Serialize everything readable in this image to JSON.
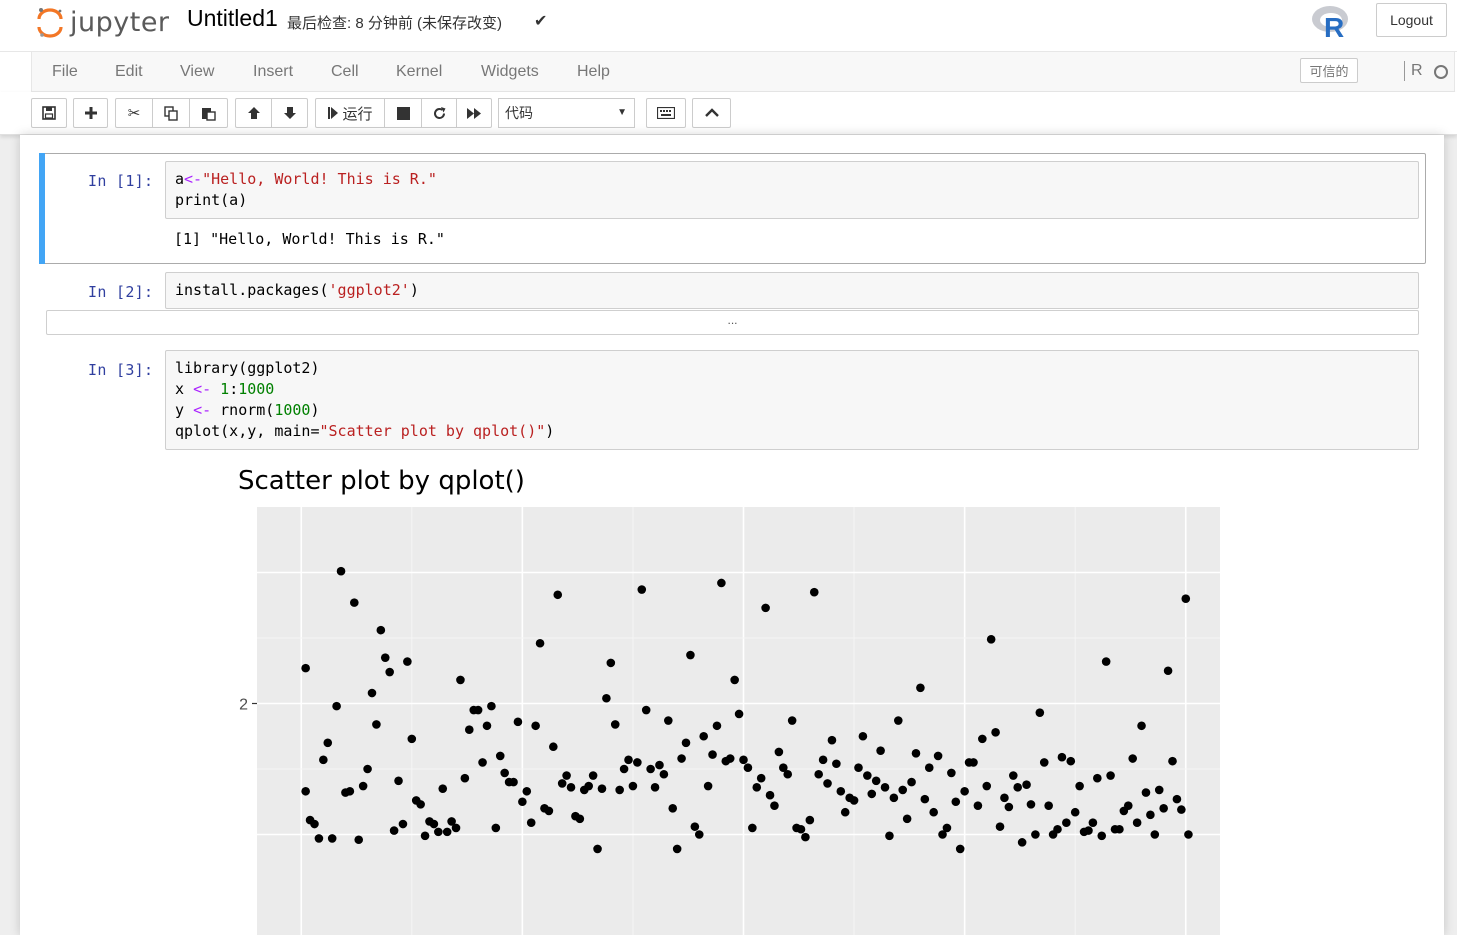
{
  "header": {
    "logo_text": "jupyter",
    "notebook_name": "Untitled1",
    "save_status": "最后检查: 8 分钟前  (未保存改变)",
    "logout_label": "Logout"
  },
  "menubar": {
    "items": [
      "File",
      "Edit",
      "View",
      "Insert",
      "Cell",
      "Kernel",
      "Widgets",
      "Help"
    ],
    "trusted_label": "可信的",
    "kernel_name": "R"
  },
  "toolbar": {
    "run_label": "运行",
    "cell_type": "代码",
    "icons": [
      "save-icon",
      "plus-icon",
      "cut-icon",
      "copy-icon",
      "paste-icon",
      "arrow-up-icon",
      "arrow-down-icon",
      "step-forward-icon",
      "stop-icon",
      "refresh-icon",
      "fast-forward-icon",
      "keyboard-icon",
      "chevron-up-icon"
    ]
  },
  "cells": [
    {
      "prompt": "In  [1]:",
      "code": [
        [
          {
            "t": "a",
            "c": ""
          },
          {
            "t": "<-",
            "c": "op"
          },
          {
            "t": "\"Hello, World! This is R.\"",
            "c": "str"
          }
        ],
        [
          {
            "t": "print(a)",
            "c": ""
          }
        ]
      ],
      "output": "[1] \"Hello, World! This is R.\""
    },
    {
      "prompt": "In  [2]:",
      "code": [
        [
          {
            "t": "install.packages(",
            "c": ""
          },
          {
            "t": "'ggplot2'",
            "c": "str"
          },
          {
            "t": ")",
            "c": ""
          }
        ]
      ],
      "output_collapsed": "..."
    },
    {
      "prompt": "In  [3]:",
      "code": [
        [
          {
            "t": "library(ggplot2)",
            "c": ""
          }
        ],
        [
          {
            "t": "x ",
            "c": ""
          },
          {
            "t": "<-",
            "c": "op"
          },
          {
            "t": " ",
            "c": ""
          },
          {
            "t": "1",
            "c": "num"
          },
          {
            "t": ":",
            "c": ""
          },
          {
            "t": "1000",
            "c": "num"
          }
        ],
        [
          {
            "t": "y ",
            "c": ""
          },
          {
            "t": "<-",
            "c": "op"
          },
          {
            "t": " rnorm(",
            "c": ""
          },
          {
            "t": "1000",
            "c": "num"
          },
          {
            "t": ")",
            "c": ""
          }
        ],
        [
          {
            "t": "qplot(x,y, main=",
            "c": ""
          },
          {
            "t": "\"Scatter plot by qplot()\"",
            "c": "str"
          },
          {
            "t": ")",
            "c": ""
          }
        ]
      ]
    }
  ],
  "chart_data": {
    "type": "scatter",
    "title": "Scatter plot by qplot()",
    "xlabel": "",
    "ylabel": "",
    "panel_background": "#ebebeb",
    "grid": true,
    "xlim": [
      -50,
      1050
    ],
    "ylim_visible": [
      -0.5,
      3.5
    ],
    "y_ticks": [
      {
        "value": 2,
        "label": "2"
      }
    ],
    "x_grid": [
      0,
      250,
      500,
      750,
      1000
    ],
    "y_grid": [
      1,
      2,
      3
    ],
    "points": [
      [
        5,
        1.33
      ],
      [
        5,
        2.27
      ],
      [
        10,
        1.11
      ],
      [
        15,
        1.08
      ],
      [
        20,
        0.97
      ],
      [
        25,
        1.57
      ],
      [
        30,
        1.7
      ],
      [
        35,
        0.97
      ],
      [
        40,
        1.98
      ],
      [
        45,
        3.01
      ],
      [
        50,
        1.32
      ],
      [
        55,
        1.33
      ],
      [
        60,
        2.77
      ],
      [
        65,
        0.96
      ],
      [
        70,
        1.37
      ],
      [
        75,
        1.5
      ],
      [
        80,
        2.08
      ],
      [
        85,
        1.84
      ],
      [
        90,
        2.56
      ],
      [
        95,
        2.35
      ],
      [
        100,
        2.24
      ],
      [
        105,
        1.03
      ],
      [
        110,
        1.41
      ],
      [
        115,
        1.08
      ],
      [
        120,
        2.32
      ],
      [
        125,
        1.73
      ],
      [
        130,
        1.26
      ],
      [
        135,
        1.23
      ],
      [
        140,
        0.99
      ],
      [
        145,
        1.1
      ],
      [
        150,
        1.08
      ],
      [
        155,
        1.02
      ],
      [
        160,
        1.35
      ],
      [
        165,
        1.02
      ],
      [
        170,
        1.1
      ],
      [
        175,
        1.05
      ],
      [
        180,
        2.18
      ],
      [
        185,
        1.43
      ],
      [
        190,
        1.8
      ],
      [
        195,
        1.95
      ],
      [
        200,
        1.95
      ],
      [
        205,
        1.55
      ],
      [
        210,
        1.83
      ],
      [
        215,
        1.98
      ],
      [
        220,
        1.05
      ],
      [
        225,
        1.6
      ],
      [
        230,
        1.47
      ],
      [
        235,
        1.4
      ],
      [
        240,
        1.4
      ],
      [
        245,
        1.86
      ],
      [
        250,
        1.25
      ],
      [
        255,
        1.33
      ],
      [
        260,
        1.09
      ],
      [
        265,
        1.83
      ],
      [
        270,
        2.46
      ],
      [
        275,
        1.2
      ],
      [
        280,
        1.18
      ],
      [
        285,
        1.67
      ],
      [
        290,
        2.83
      ],
      [
        295,
        1.39
      ],
      [
        300,
        1.45
      ],
      [
        305,
        1.36
      ],
      [
        310,
        1.14
      ],
      [
        315,
        1.12
      ],
      [
        320,
        1.34
      ],
      [
        325,
        1.37
      ],
      [
        330,
        1.45
      ],
      [
        335,
        0.89
      ],
      [
        340,
        1.35
      ],
      [
        345,
        2.04
      ],
      [
        350,
        2.31
      ],
      [
        355,
        1.84
      ],
      [
        360,
        1.34
      ],
      [
        365,
        1.5
      ],
      [
        370,
        1.57
      ],
      [
        375,
        1.37
      ],
      [
        380,
        1.55
      ],
      [
        385,
        2.87
      ],
      [
        390,
        1.95
      ],
      [
        395,
        1.5
      ],
      [
        400,
        1.36
      ],
      [
        405,
        1.53
      ],
      [
        410,
        1.46
      ],
      [
        415,
        1.87
      ],
      [
        420,
        1.2
      ],
      [
        425,
        0.89
      ],
      [
        430,
        1.58
      ],
      [
        435,
        1.7
      ],
      [
        440,
        2.37
      ],
      [
        445,
        1.06
      ],
      [
        450,
        1.0
      ],
      [
        455,
        1.75
      ],
      [
        460,
        1.37
      ],
      [
        465,
        1.61
      ],
      [
        470,
        1.83
      ],
      [
        475,
        2.92
      ],
      [
        480,
        1.56
      ],
      [
        485,
        1.58
      ],
      [
        490,
        2.18
      ],
      [
        495,
        1.92
      ],
      [
        500,
        1.57
      ],
      [
        505,
        1.51
      ],
      [
        510,
        1.05
      ],
      [
        515,
        1.36
      ],
      [
        520,
        1.43
      ],
      [
        525,
        2.73
      ],
      [
        530,
        1.3
      ],
      [
        535,
        1.22
      ],
      [
        540,
        1.63
      ],
      [
        545,
        1.51
      ],
      [
        550,
        1.46
      ],
      [
        555,
        1.87
      ],
      [
        560,
        1.05
      ],
      [
        565,
        1.04
      ],
      [
        570,
        0.98
      ],
      [
        575,
        1.11
      ],
      [
        580,
        2.85
      ],
      [
        585,
        1.46
      ],
      [
        590,
        1.57
      ],
      [
        595,
        1.39
      ],
      [
        600,
        1.72
      ],
      [
        605,
        1.54
      ],
      [
        610,
        1.33
      ],
      [
        615,
        1.17
      ],
      [
        620,
        1.28
      ],
      [
        625,
        1.26
      ],
      [
        630,
        1.51
      ],
      [
        635,
        1.75
      ],
      [
        640,
        1.45
      ],
      [
        645,
        1.31
      ],
      [
        650,
        1.41
      ],
      [
        655,
        1.64
      ],
      [
        660,
        1.36
      ],
      [
        665,
        0.99
      ],
      [
        670,
        1.28
      ],
      [
        675,
        1.87
      ],
      [
        680,
        1.34
      ],
      [
        685,
        1.12
      ],
      [
        690,
        1.4
      ],
      [
        695,
        1.62
      ],
      [
        700,
        2.12
      ],
      [
        705,
        1.27
      ],
      [
        710,
        1.51
      ],
      [
        715,
        1.17
      ],
      [
        720,
        1.6
      ],
      [
        725,
        1.0
      ],
      [
        730,
        1.05
      ],
      [
        735,
        1.47
      ],
      [
        740,
        1.25
      ],
      [
        745,
        0.89
      ],
      [
        750,
        1.33
      ],
      [
        755,
        1.55
      ],
      [
        760,
        1.55
      ],
      [
        765,
        1.22
      ],
      [
        770,
        1.73
      ],
      [
        775,
        1.37
      ],
      [
        780,
        2.49
      ],
      [
        785,
        1.78
      ],
      [
        790,
        1.06
      ],
      [
        795,
        1.28
      ],
      [
        800,
        1.21
      ],
      [
        805,
        1.45
      ],
      [
        810,
        1.36
      ],
      [
        815,
        0.94
      ],
      [
        820,
        1.38
      ],
      [
        825,
        1.23
      ],
      [
        830,
        1.0
      ],
      [
        835,
        1.93
      ],
      [
        840,
        1.55
      ],
      [
        845,
        1.22
      ],
      [
        850,
        1.0
      ],
      [
        855,
        1.04
      ],
      [
        860,
        1.59
      ],
      [
        865,
        1.09
      ],
      [
        870,
        1.56
      ],
      [
        875,
        1.17
      ],
      [
        880,
        1.37
      ],
      [
        885,
        1.02
      ],
      [
        890,
        1.03
      ],
      [
        895,
        1.09
      ],
      [
        900,
        1.43
      ],
      [
        905,
        0.99
      ],
      [
        910,
        2.32
      ],
      [
        915,
        1.45
      ],
      [
        920,
        1.04
      ],
      [
        925,
        1.04
      ],
      [
        930,
        1.18
      ],
      [
        935,
        1.22
      ],
      [
        940,
        1.58
      ],
      [
        945,
        1.09
      ],
      [
        950,
        1.83
      ],
      [
        955,
        1.32
      ],
      [
        960,
        1.15
      ],
      [
        965,
        1.0
      ],
      [
        970,
        1.34
      ],
      [
        975,
        1.2
      ],
      [
        980,
        2.25
      ],
      [
        985,
        1.56
      ],
      [
        990,
        1.27
      ],
      [
        995,
        1.19
      ],
      [
        1000,
        2.8
      ],
      [
        1003,
        1.0
      ]
    ]
  }
}
